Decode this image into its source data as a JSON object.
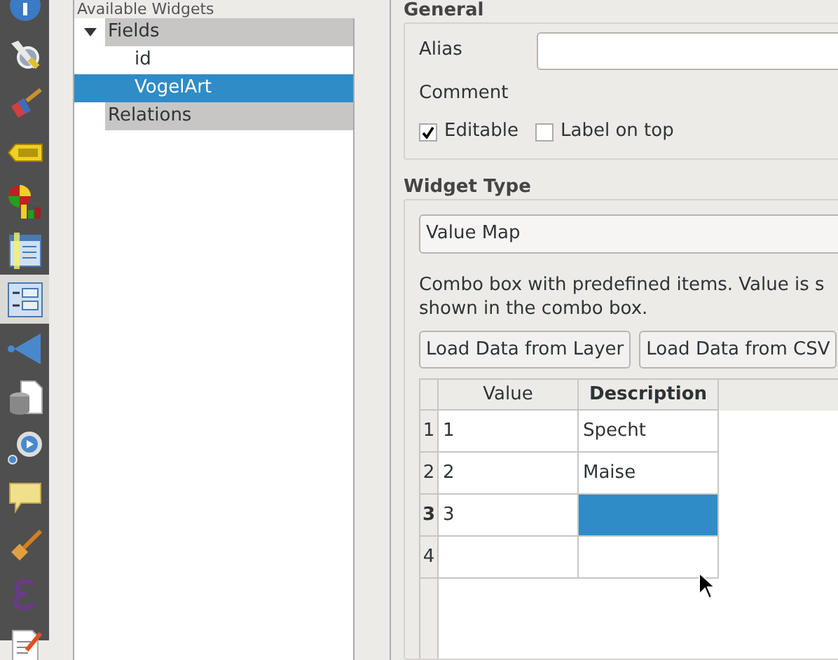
{
  "toolbar": {
    "items": [
      {
        "kind": "info",
        "selected": false
      },
      {
        "kind": "tools",
        "selected": false
      },
      {
        "kind": "brush",
        "selected": false
      },
      {
        "kind": "label",
        "selected": false
      },
      {
        "kind": "diagram",
        "selected": false
      },
      {
        "kind": "form",
        "selected": false
      },
      {
        "kind": "fields",
        "selected": true
      },
      {
        "kind": "actions",
        "selected": false
      },
      {
        "kind": "source",
        "selected": false
      },
      {
        "kind": "rendering",
        "selected": false
      },
      {
        "kind": "tip",
        "selected": false
      },
      {
        "kind": "paint",
        "selected": false
      },
      {
        "kind": "variables",
        "selected": false
      },
      {
        "kind": "metadata",
        "selected": false
      }
    ]
  },
  "widgets_panel": {
    "title": "Available Widgets",
    "tree": [
      {
        "label": "Fields",
        "expanded": true,
        "selected": false,
        "children": [
          {
            "label": "id",
            "selected": false
          },
          {
            "label": "VogelArt",
            "selected": true
          }
        ]
      },
      {
        "label": "Relations",
        "selected": false
      }
    ]
  },
  "general": {
    "title": "General",
    "alias_label": "Alias",
    "comment_label": "Comment",
    "checkboxes": [
      {
        "label": "Editable",
        "checked": true
      },
      {
        "label": "Label on top",
        "checked": false
      }
    ]
  },
  "widget_type": {
    "title": "Widget Type",
    "combo_value": "Value Map",
    "description": "Combo box with predefined items. Value is s",
    "description_line2": "shown in the combo box.",
    "buttons": [
      "Load Data from Layer",
      "Load Data from CSV"
    ],
    "table": {
      "columns": [
        "Value",
        "Description"
      ],
      "rows": [
        {
          "header": "1",
          "cells": [
            {
              "text": "1",
              "selected": false
            },
            {
              "text": "Specht",
              "selected": false
            }
          ],
          "current": false
        },
        {
          "header": "2",
          "cells": [
            {
              "text": "2",
              "selected": false
            },
            {
              "text": "Maise",
              "selected": false
            }
          ],
          "current": false
        },
        {
          "header": "3",
          "cells": [
            {
              "text": "3",
              "selected": false
            },
            {
              "text": "",
              "selected": true
            }
          ],
          "current": true
        },
        {
          "header": "4",
          "cells": [
            {
              "text": "",
              "selected": false
            },
            {
              "text": "",
              "selected": false
            }
          ],
          "current": false
        }
      ]
    }
  }
}
